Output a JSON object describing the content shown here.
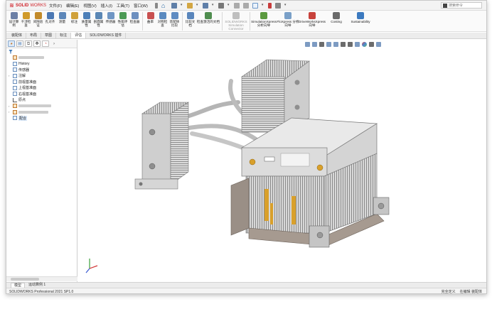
{
  "app": {
    "logo_icon": "ds-logo",
    "brand_bold": "SOLID",
    "brand_light": "WORKS"
  },
  "menus": [
    {
      "label": "文件(F)"
    },
    {
      "label": "编辑(E)"
    },
    {
      "label": "视图(V)"
    },
    {
      "label": "插入(I)"
    },
    {
      "label": "工具(T)"
    },
    {
      "label": "窗口(W)"
    }
  ],
  "search": {
    "placeholder": "搜索命令"
  },
  "ribbon": [
    {
      "label": "设计算例",
      "icon": "study-icon",
      "color": "#6b7fa6"
    },
    {
      "label": "干涉检查",
      "icon": "interference-icon",
      "color": "#d09a2a"
    },
    {
      "label": "间隙验证",
      "icon": "clearance-icon",
      "color": "#c28a2a"
    },
    {
      "label": "孔对齐",
      "icon": "hole-align-icon",
      "color": "#4b78b4"
    },
    {
      "label": "测量",
      "icon": "measure-icon",
      "color": "#5d87b9"
    },
    {
      "label": "标注",
      "icon": "markup-icon",
      "color": "#d0a13a"
    },
    {
      "label": "质量属性",
      "icon": "mass-props-icon",
      "color": "#4d7fb8"
    },
    {
      "label": "剖面属性",
      "icon": "section-props-icon",
      "color": "#5a87b5"
    },
    {
      "label": "传感器",
      "icon": "sensor-icon",
      "color": "#6f96c4"
    },
    {
      "label": "性能评估",
      "icon": "performance-icon",
      "color": "#4c9a55"
    },
    {
      "label": "检查器",
      "icon": "checker-icon",
      "color": "#6c8fbf"
    },
    {
      "label": "曲率",
      "icon": "curvature-icon",
      "color": "#c85050"
    },
    {
      "label": "对称检查",
      "icon": "symmetry-icon",
      "color": "#5a8ac0"
    },
    {
      "label": "装配体比较",
      "icon": "compare-icon",
      "color": "#5f8cc2"
    },
    {
      "label": "比较文档",
      "icon": "compare-docs-icon",
      "color": "#5a86bc"
    },
    {
      "label": "检查激活的文档",
      "icon": "check-doc-icon",
      "color": "#4f8d4f"
    },
    {
      "label": "SOLIDWORKS Simulation Connector",
      "icon": "simulation-connector-icon",
      "color": "#bfbfbf",
      "dim": true
    },
    {
      "label": "SimulationXpress 分析向导",
      "icon": "simxpress-icon",
      "color": "#5b9a3f"
    },
    {
      "label": "FloXpress 分析向导",
      "icon": "floxpress-icon",
      "color": "#7aa0c8"
    },
    {
      "label": "DriveWorksXpress 向导",
      "icon": "driveworks-icon",
      "color": "#c8423c"
    },
    {
      "label": "Costing",
      "icon": "costing-icon",
      "color": "#6a6a6a"
    },
    {
      "label": "Sustainability",
      "icon": "sustainability-icon",
      "color": "#3c7ac0"
    }
  ],
  "command_tabs": [
    {
      "label": "装配体"
    },
    {
      "label": "布局"
    },
    {
      "label": "草图"
    },
    {
      "label": "标注"
    },
    {
      "label": "评估",
      "active": true
    },
    {
      "label": "SOLIDWORKS 插件"
    }
  ],
  "tree": {
    "items": [
      {
        "label": "History",
        "icon": "history-icon"
      },
      {
        "label": "传感器",
        "icon": "sensor-icon"
      },
      {
        "label": "注解",
        "icon": "annotations-icon",
        "expandable": true
      },
      {
        "label": "前视基准面",
        "icon": "plane-icon"
      },
      {
        "label": "上视基准面",
        "icon": "plane-icon"
      },
      {
        "label": "右视基准面",
        "icon": "plane-icon"
      },
      {
        "label": "原点",
        "icon": "origin-icon"
      },
      {
        "label": "配合",
        "icon": "mates-icon"
      }
    ]
  },
  "model_tabs": [
    {
      "label": "模型",
      "active": true
    },
    {
      "label": "运动算例 1"
    }
  ],
  "status": {
    "product": "SOLIDWORKS Professional 2021 SP1.0",
    "right_1": "完全定义",
    "right_2": "在编辑 装配体"
  },
  "colors": {
    "accent_red": "#d0242b",
    "selection": "#d7e6f8",
    "fin_metal": "#c9c9c9",
    "heatpipe": "#bcbcbc",
    "bracket_gold": "#d9a02b"
  }
}
